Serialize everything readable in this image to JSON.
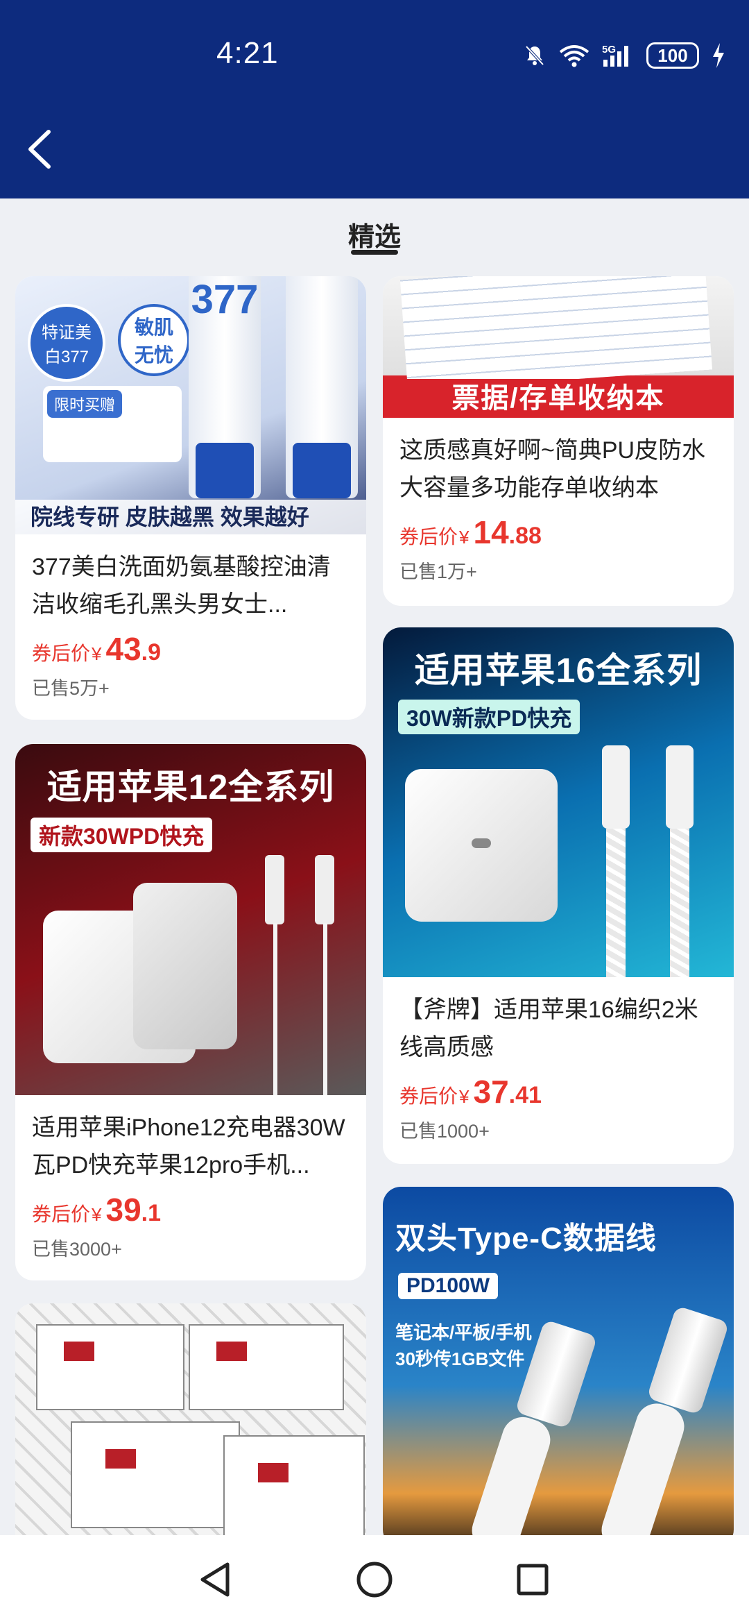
{
  "status_bar": {
    "time": "4:21",
    "battery": "100",
    "network": "5G",
    "icons": [
      "mute-icon",
      "wifi-icon",
      "signal-icon",
      "battery-icon",
      "charging-icon"
    ]
  },
  "header": {
    "color": "#0d2b7e"
  },
  "page": {
    "title": "精选"
  },
  "products": [
    {
      "name": "377美白洗面奶氨基酸控油清洁收缩毛孔黑头男女士...",
      "price_label": "券后价",
      "currency": "¥",
      "price_int": "43",
      "price_dec": ".9",
      "sold": "已售5万+",
      "image": {
        "badge1": "特证美白377",
        "badge2": "敏肌无忧",
        "tag": "限时买赠",
        "bottom": "院线专研 皮肤越黑 效果越好",
        "tube": "377"
      }
    },
    {
      "name": "这质感真好啊~简典PU皮防水大容量多功能存单收纳本",
      "price_label": "券后价",
      "currency": "¥",
      "price_int": "14",
      "price_dec": ".88",
      "sold": "已售1万+",
      "image": {
        "banner": "票据/存单收纳本"
      }
    },
    {
      "name": "适用苹果iPhone12充电器30W瓦PD快充苹果12pro手机...",
      "price_label": "券后价",
      "currency": "¥",
      "price_int": "39",
      "price_dec": ".1",
      "sold": "已售3000+",
      "image": {
        "headline": "适用苹果12全系列",
        "tag": "新款30WPD快充"
      }
    },
    {
      "name": "【斧牌】适用苹果16编织2米线高质感",
      "price_label": "券后价",
      "currency": "¥",
      "price_int": "37",
      "price_dec": ".41",
      "sold": "已售1000+",
      "image": {
        "headline": "适用苹果16全系列",
        "tag": "30W新款PD快充"
      }
    },
    {
      "name": "",
      "image": {}
    },
    {
      "name": "",
      "image": {
        "headline": "双头Type-C数据线",
        "tag": "PD100W",
        "line1": "笔记本/平板/手机",
        "line2": "30秒传1GB文件"
      }
    }
  ],
  "colors": {
    "price": "#e8362d",
    "background": "#eef0f4"
  }
}
